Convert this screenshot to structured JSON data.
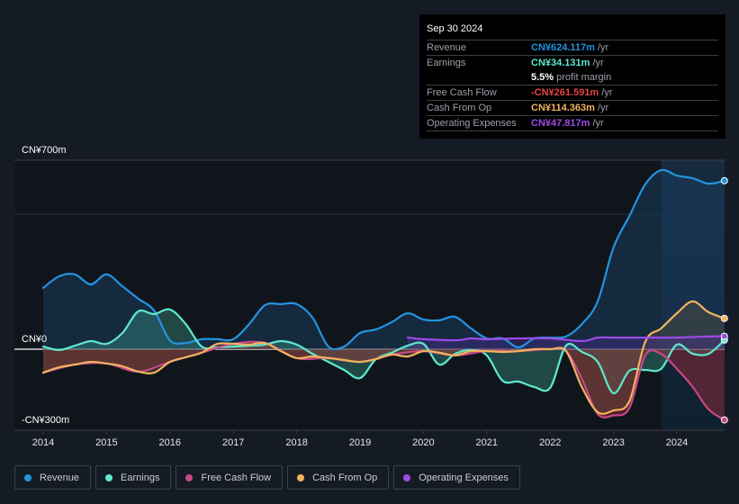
{
  "tooltip": {
    "date": "Sep 30 2024",
    "rows": [
      {
        "label": "Revenue",
        "value": "CN¥624.117m",
        "unit": "/yr",
        "color": "#2394df"
      },
      {
        "label": "Earnings",
        "value": "CN¥34.131m",
        "unit": "/yr",
        "color": "#5ee8cf"
      },
      {
        "label": "",
        "value": "5.5%",
        "unit": "profit margin",
        "color": "#ffffff"
      },
      {
        "label": "Free Cash Flow",
        "value": "-CN¥261.591m",
        "unit": "/yr",
        "color": "#e64545"
      },
      {
        "label": "Cash From Op",
        "value": "CN¥114.363m",
        "unit": "/yr",
        "color": "#f2b35f"
      },
      {
        "label": "Operating Expenses",
        "value": "CN¥47.817m",
        "unit": "/yr",
        "color": "#9d4ae8"
      }
    ]
  },
  "legend": [
    {
      "label": "Revenue",
      "color": "#2394df"
    },
    {
      "label": "Earnings",
      "color": "#5ee8cf"
    },
    {
      "label": "Free Cash Flow",
      "color": "#c74887"
    },
    {
      "label": "Cash From Op",
      "color": "#f2b35f"
    },
    {
      "label": "Operating Expenses",
      "color": "#9d4ae8"
    }
  ],
  "chart_data": {
    "type": "area",
    "title": "",
    "xlabel": "",
    "ylabel": "",
    "y_tick_labels": [
      "CN¥700m",
      "CN¥0",
      "-CN¥300m"
    ],
    "y_ticks": [
      700,
      0,
      -300
    ],
    "ylim": [
      -300,
      700
    ],
    "xlim": [
      2013.55,
      2024.75
    ],
    "x_tick_labels": [
      "2014",
      "2015",
      "2016",
      "2017",
      "2018",
      "2019",
      "2020",
      "2021",
      "2022",
      "2023",
      "2024"
    ],
    "x_ticks": [
      2014,
      2015,
      2016,
      2017,
      2018,
      2019,
      2020,
      2021,
      2022,
      2023,
      2024
    ],
    "grid": true,
    "highlight_from": 2023.75,
    "legend_position": "bottom",
    "series": [
      {
        "name": "Revenue",
        "color": "#2394df",
        "x": [
          2014.0,
          2014.25,
          2014.5,
          2014.75,
          2015.0,
          2015.25,
          2015.5,
          2015.75,
          2016.0,
          2016.25,
          2016.5,
          2016.75,
          2017.0,
          2017.25,
          2017.5,
          2017.75,
          2018.0,
          2018.25,
          2018.5,
          2018.75,
          2019.0,
          2019.25,
          2019.5,
          2019.75,
          2020.0,
          2020.25,
          2020.5,
          2020.75,
          2021.0,
          2021.25,
          2021.5,
          2021.75,
          2022.0,
          2022.25,
          2022.5,
          2022.75,
          2023.0,
          2023.25,
          2023.5,
          2023.75,
          2024.0,
          2024.25,
          2024.5,
          2024.75
        ],
        "values": [
          227,
          270,
          277,
          240,
          277,
          233,
          187,
          143,
          33,
          23,
          37,
          37,
          37,
          93,
          163,
          167,
          167,
          117,
          10,
          10,
          60,
          73,
          100,
          133,
          110,
          107,
          120,
          77,
          40,
          40,
          7,
          40,
          43,
          47,
          93,
          177,
          377,
          493,
          610,
          663,
          643,
          633,
          613,
          624
        ]
      },
      {
        "name": "Earnings",
        "color": "#5ee8cf",
        "x": [
          2014.0,
          2014.25,
          2014.5,
          2014.75,
          2015.0,
          2015.25,
          2015.5,
          2015.75,
          2016.0,
          2016.25,
          2016.5,
          2016.75,
          2017.0,
          2017.25,
          2017.5,
          2017.75,
          2018.0,
          2018.25,
          2018.5,
          2018.75,
          2019.0,
          2019.25,
          2019.5,
          2019.75,
          2020.0,
          2020.25,
          2020.5,
          2020.75,
          2021.0,
          2021.25,
          2021.5,
          2021.75,
          2022.0,
          2022.25,
          2022.5,
          2022.75,
          2023.0,
          2023.25,
          2023.5,
          2023.75,
          2024.0,
          2024.25,
          2024.5,
          2024.75
        ],
        "values": [
          10,
          -3,
          13,
          30,
          20,
          60,
          140,
          130,
          147,
          93,
          10,
          7,
          10,
          13,
          17,
          30,
          17,
          -17,
          -47,
          -77,
          -107,
          -37,
          -13,
          13,
          20,
          -57,
          -17,
          -3,
          -23,
          -117,
          -120,
          -140,
          -143,
          13,
          -10,
          -47,
          -163,
          -80,
          -77,
          -73,
          17,
          -17,
          -17,
          34
        ]
      },
      {
        "name": "Free Cash Flow",
        "color": "#c74887",
        "x": [
          2014.0,
          2014.5,
          2015.0,
          2015.5,
          2016.0,
          2016.5,
          2017.0,
          2017.5,
          2018.0,
          2018.5,
          2019.0,
          2019.5,
          2020.0,
          2020.5,
          2021.0,
          2021.5,
          2022.0,
          2022.25,
          2022.5,
          2022.75,
          2023.0,
          2023.25,
          2023.5,
          2023.75,
          2024.0,
          2024.25,
          2024.5,
          2024.75
        ],
        "values": [
          -87,
          -57,
          -53,
          -83,
          -47,
          -13,
          20,
          23,
          -33,
          -33,
          -47,
          -20,
          -7,
          -23,
          -7,
          -7,
          0,
          -7,
          -110,
          -240,
          -245,
          -218,
          -23,
          -17,
          -73,
          -140,
          -223,
          -262
        ]
      },
      {
        "name": "Cash From Op",
        "color": "#f2b35f",
        "x": [
          2014.0,
          2014.25,
          2014.5,
          2014.75,
          2015.0,
          2015.25,
          2015.5,
          2015.75,
          2016.0,
          2016.25,
          2016.5,
          2016.75,
          2017.0,
          2017.25,
          2017.5,
          2017.75,
          2018.0,
          2018.25,
          2018.5,
          2018.75,
          2019.0,
          2019.25,
          2019.5,
          2019.75,
          2020.0,
          2020.25,
          2020.5,
          2020.75,
          2021.0,
          2021.25,
          2021.5,
          2021.75,
          2022.0,
          2022.25,
          2022.5,
          2022.75,
          2023.0,
          2023.25,
          2023.5,
          2023.75,
          2024.0,
          2024.25,
          2024.5,
          2024.75
        ],
        "values": [
          -87,
          -67,
          -57,
          -47,
          -53,
          -63,
          -83,
          -87,
          -47,
          -30,
          -13,
          20,
          20,
          17,
          23,
          -7,
          -33,
          -27,
          -33,
          -40,
          -47,
          -37,
          -20,
          -27,
          -7,
          -13,
          -23,
          -7,
          -7,
          -10,
          -7,
          0,
          0,
          -7,
          -140,
          -233,
          -227,
          -193,
          27,
          77,
          133,
          177,
          137,
          114
        ]
      },
      {
        "name": "Operating Expenses",
        "color": "#9d4ae8",
        "x": [
          2019.75,
          2020.0,
          2020.5,
          2020.75,
          2021.0,
          2021.5,
          2022.0,
          2022.5,
          2022.75,
          2023.0,
          2023.5,
          2024.0,
          2024.5,
          2024.75
        ],
        "values": [
          43,
          37,
          33,
          40,
          37,
          40,
          40,
          30,
          43,
          43,
          43,
          43,
          47,
          48
        ]
      }
    ]
  }
}
